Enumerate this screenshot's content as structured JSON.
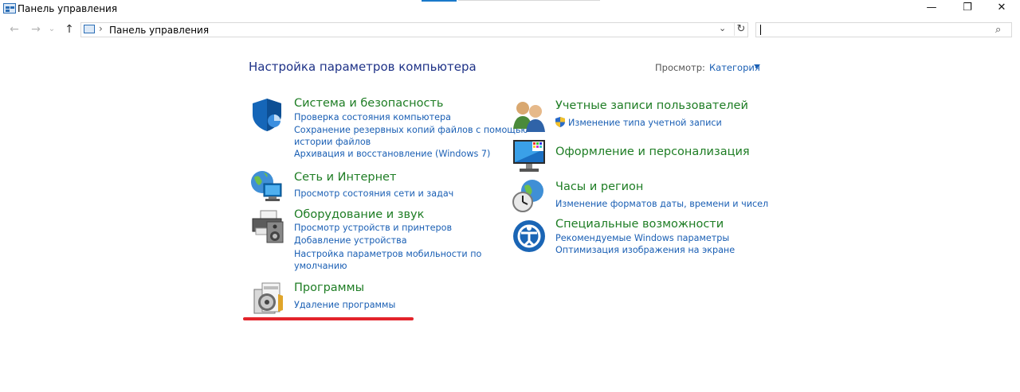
{
  "window": {
    "title": "Панель управления",
    "controls": {
      "minimize": "—",
      "restore": "❐",
      "close": "✕"
    }
  },
  "nav": {
    "back": "←",
    "forward": "→",
    "recent": "⌄",
    "up": "↑",
    "breadcrumb_separator": "›",
    "address": "Панель управления",
    "dropdown": "⌄",
    "refresh": "↻",
    "search_value": "",
    "search_icon": "⌕"
  },
  "page": {
    "title": "Настройка параметров компьютера",
    "view_label": "Просмотр:",
    "view_value": "Категория"
  },
  "categories": {
    "system": {
      "title": "Система и безопасность",
      "links": [
        "Проверка состояния компьютера",
        "Сохранение резервных копий файлов с помощью",
        "истории файлов",
        "Архивация и восстановление (Windows 7)"
      ],
      "icon": "shield-icon"
    },
    "network": {
      "title": "Сеть и Интернет",
      "links": [
        "Просмотр состояния сети и задач"
      ],
      "icon": "network-globe-icon"
    },
    "hardware": {
      "title": "Оборудование и звук",
      "links": [
        "Просмотр устройств и принтеров",
        "Добавление устройства",
        "Настройка параметров мобильности по",
        "умолчанию"
      ],
      "icon": "printer-speaker-icon"
    },
    "programs": {
      "title": "Программы",
      "links": [
        "Удаление программы"
      ],
      "icon": "programs-disc-icon"
    },
    "accounts": {
      "title": "Учетные записи пользователей",
      "links": [
        "Изменение типа учетной записи"
      ],
      "icon": "users-icon"
    },
    "appearance": {
      "title": "Оформление и персонализация",
      "links": [],
      "icon": "monitor-palette-icon"
    },
    "clock": {
      "title": "Часы и регион",
      "links": [
        "Изменение форматов даты, времени и чисел"
      ],
      "icon": "clock-globe-icon"
    },
    "access": {
      "title": "Специальные возможности",
      "links": [
        "Рекомендуемые Windows параметры",
        "Оптимизация изображения на экране"
      ],
      "icon": "ease-of-access-icon"
    }
  },
  "colors": {
    "category_title": "#1e7d24",
    "link": "#1a5fb4",
    "page_title": "#1e3287",
    "highlight_underline": "#e3242b"
  }
}
